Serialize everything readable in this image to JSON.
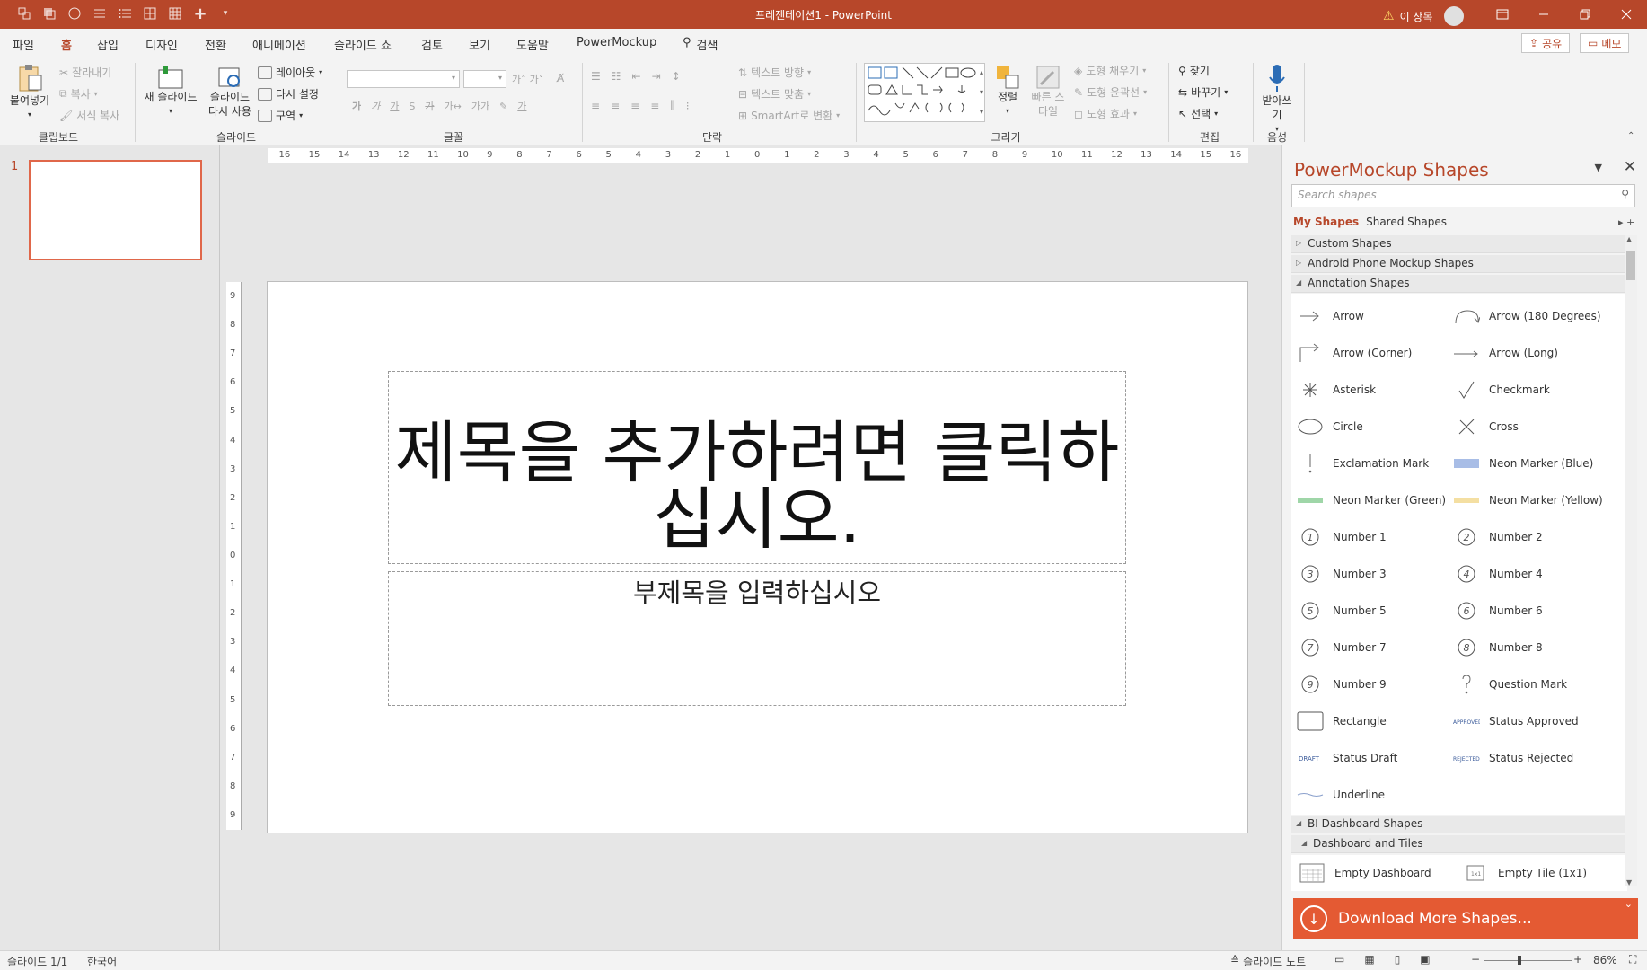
{
  "app": {
    "doc_title": "프레젠테이션1 - PowerPoint",
    "warning_label": "이 상목",
    "accent": "#b7472a"
  },
  "tabs": [
    {
      "label": "파일"
    },
    {
      "label": "홈"
    },
    {
      "label": "삽입"
    },
    {
      "label": "디자인"
    },
    {
      "label": "전환"
    },
    {
      "label": "애니메이션"
    },
    {
      "label": "슬라이드 쇼"
    },
    {
      "label": "검토"
    },
    {
      "label": "보기"
    },
    {
      "label": "도움말"
    },
    {
      "label": "PowerMockup"
    },
    {
      "label": "검색"
    }
  ],
  "top_buttons": {
    "share": "공유",
    "memo": "메모"
  },
  "ribbon": {
    "clipboard": {
      "paste": "붙여넣기",
      "cut": "잘라내기",
      "copy": "복사",
      "format_copy": "서식 복사",
      "group": "클립보드"
    },
    "slides": {
      "new_slide": "새 슬라이드",
      "reuse": "슬라이드 다시 사용",
      "layout": "레이아웃",
      "reset": "다시 설정",
      "section": "구역",
      "group": "슬라이드"
    },
    "font": {
      "group": "글꼴"
    },
    "paragraph": {
      "text_direction": "텍스트 방향",
      "text_align": "텍스트 맞춤",
      "smartart": "SmartArt로 변환",
      "group": "단락"
    },
    "drawing": {
      "arrange": "정렬",
      "quick_styles": "빠른 스타일",
      "fill": "도형 채우기",
      "outline": "도형 윤곽선",
      "effects": "도형 효과",
      "group": "그리기"
    },
    "editing": {
      "find": "찾기",
      "replace": "바꾸기",
      "select": "선택",
      "group": "편집"
    },
    "voice": {
      "dictate": "받아쓰기",
      "group": "음성"
    }
  },
  "thumbnail": {
    "number": "1"
  },
  "slide": {
    "title_placeholder": "제목을 추가하려면 클릭하십시오.",
    "subtitle_placeholder": "부제목을 입력하십시오"
  },
  "rulers": {
    "h_ticks": [
      "16",
      "15",
      "14",
      "13",
      "12",
      "11",
      "10",
      "9",
      "8",
      "7",
      "6",
      "5",
      "4",
      "3",
      "2",
      "1",
      "0",
      "1",
      "2",
      "3",
      "4",
      "5",
      "6",
      "7",
      "8",
      "9",
      "10",
      "11",
      "12",
      "13",
      "14",
      "15",
      "16"
    ],
    "v_ticks": [
      "9",
      "8",
      "7",
      "6",
      "5",
      "4",
      "3",
      "2",
      "1",
      "0",
      "1",
      "2",
      "3",
      "4",
      "5",
      "6",
      "7",
      "8",
      "9"
    ]
  },
  "panel": {
    "title": "PowerMockup Shapes",
    "search_placeholder": "Search shapes",
    "tab_my": "My Shapes",
    "tab_shared": "Shared Shapes",
    "categories": [
      {
        "label": "Custom Shapes",
        "open": false
      },
      {
        "label": "Android Phone Mockup Shapes",
        "open": false
      },
      {
        "label": "Annotation Shapes",
        "open": true
      }
    ],
    "annotation_items": [
      {
        "label": "Arrow",
        "icon": "arrow-icon"
      },
      {
        "label": "Arrow (180 Degrees)",
        "icon": "arrow-180-icon"
      },
      {
        "label": "Arrow (Corner)",
        "icon": "arrow-corner-icon"
      },
      {
        "label": "Arrow (Long)",
        "icon": "arrow-long-icon"
      },
      {
        "label": "Asterisk",
        "icon": "asterisk-icon"
      },
      {
        "label": "Checkmark",
        "icon": "checkmark-icon"
      },
      {
        "label": "Circle",
        "icon": "circle-icon"
      },
      {
        "label": "Cross",
        "icon": "cross-icon"
      },
      {
        "label": "Exclamation Mark",
        "icon": "exclamation-icon"
      },
      {
        "label": "Neon Marker (Blue)",
        "icon": "neon-blue-icon"
      },
      {
        "label": "Neon Marker (Green)",
        "icon": "neon-green-icon"
      },
      {
        "label": "Neon Marker (Yellow)",
        "icon": "neon-yellow-icon"
      },
      {
        "label": "Number 1",
        "icon": "number-icon"
      },
      {
        "label": "Number 2",
        "icon": "number-icon"
      },
      {
        "label": "Number 3",
        "icon": "number-icon"
      },
      {
        "label": "Number 4",
        "icon": "number-icon"
      },
      {
        "label": "Number 5",
        "icon": "number-icon"
      },
      {
        "label": "Number 6",
        "icon": "number-icon"
      },
      {
        "label": "Number 7",
        "icon": "number-icon"
      },
      {
        "label": "Number 8",
        "icon": "number-icon"
      },
      {
        "label": "Number 9",
        "icon": "number-icon"
      },
      {
        "label": "Question Mark",
        "icon": "question-icon"
      },
      {
        "label": "Rectangle",
        "icon": "rectangle-icon"
      },
      {
        "label": "Status Approved",
        "icon": "status-approved-icon"
      },
      {
        "label": "Status Draft",
        "icon": "status-draft-icon"
      },
      {
        "label": "Status Rejected",
        "icon": "status-rejected-icon"
      },
      {
        "label": "Underline",
        "icon": "underline-icon"
      }
    ],
    "bi_category": "BI Dashboard Shapes",
    "dash_category": "Dashboard and Tiles",
    "dash_items": [
      {
        "label": "Empty Dashboard"
      },
      {
        "label": "Empty Tile (1x1)"
      }
    ],
    "download": "Download More Shapes..."
  },
  "status": {
    "slide_count": "슬라이드 1/1",
    "language": "한국어",
    "notes": "슬라이드 노트",
    "zoom": "86%"
  }
}
